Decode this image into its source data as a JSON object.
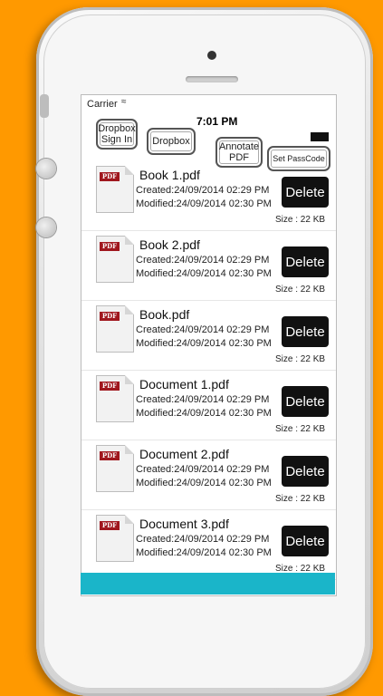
{
  "status": {
    "carrier": "Carrier",
    "time": "7:01 PM"
  },
  "toolbar": {
    "dropbox_signin": "Dropbox Sign In",
    "dropbox": "Dropbox",
    "annotate": "Annotate PDF",
    "passcode": "Set PassCode"
  },
  "files": [
    {
      "name": "Book 1.pdf",
      "created": "Created:24/09/2014 02:29 PM",
      "modified": "Modified:24/09/2014 02:30 PM",
      "size": "Size : 22 KB",
      "delete": "Delete"
    },
    {
      "name": "Book 2.pdf",
      "created": "Created:24/09/2014 02:29 PM",
      "modified": "Modified:24/09/2014 02:30 PM",
      "size": "Size : 22 KB",
      "delete": "Delete"
    },
    {
      "name": "Book.pdf",
      "created": "Created:24/09/2014 02:29 PM",
      "modified": "Modified:24/09/2014 02:30 PM",
      "size": "Size : 22 KB",
      "delete": "Delete"
    },
    {
      "name": "Document 1.pdf",
      "created": "Created:24/09/2014 02:29 PM",
      "modified": "Modified:24/09/2014 02:30 PM",
      "size": "Size : 22 KB",
      "delete": "Delete"
    },
    {
      "name": "Document 2.pdf",
      "created": "Created:24/09/2014 02:29 PM",
      "modified": "Modified:24/09/2014 02:30 PM",
      "size": "Size : 22 KB",
      "delete": "Delete"
    },
    {
      "name": "Document 3.pdf",
      "created": "Created:24/09/2014 02:29 PM",
      "modified": "Modified:24/09/2014 02:30 PM",
      "size": "Size : 22 KB",
      "delete": "Delete"
    }
  ],
  "pdf_badge": "PDF",
  "colors": {
    "background": "#ff9900",
    "accent_bar": "#1ab5c9",
    "delete_button": "#111111",
    "pdf_badge": "#a0171e"
  }
}
